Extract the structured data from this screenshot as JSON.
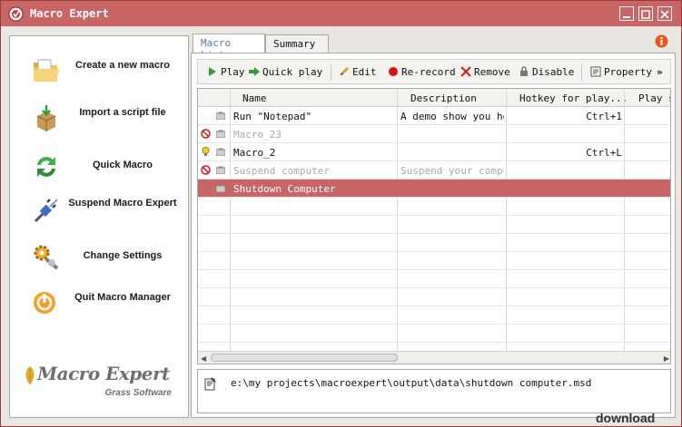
{
  "window": {
    "title": "Macro Expert"
  },
  "sidebar": {
    "actions": [
      {
        "label": "Create a new macro",
        "icon": "folder-icon"
      },
      {
        "label": "Import a script file",
        "icon": "package-icon"
      },
      {
        "label": "Quick Macro",
        "icon": "refresh-icon"
      },
      {
        "label": "Suspend Macro Expert",
        "icon": "plug-icon"
      },
      {
        "label": "Change Settings",
        "icon": "settings-icon"
      },
      {
        "label": "Quit Macro Manager",
        "icon": "power-icon"
      }
    ],
    "brand": {
      "name": "Macro Expert",
      "sub": "Grass Software"
    }
  },
  "tabs": [
    {
      "label": "Macro List"
    },
    {
      "label": "Summary"
    }
  ],
  "toolbar": {
    "play": "Play",
    "quick_play": "Quick play",
    "edit": "Edit",
    "rerecord": "Re-record",
    "remove": "Remove",
    "disable": "Disable",
    "property": "Property",
    "more": "»"
  },
  "table": {
    "columns": [
      "Name",
      "Description",
      "Hotkey for play...",
      "Play s"
    ],
    "rows": [
      {
        "name": "Run \"Notepad\"",
        "description": "A demo show you how",
        "hotkey": "Ctrl+1",
        "status": "enabled",
        "selected": false
      },
      {
        "name": "Macro_23",
        "description": "",
        "hotkey": "",
        "status": "disabled",
        "selected": false
      },
      {
        "name": "Macro_2",
        "description": "",
        "hotkey": "Ctrl+L",
        "status": "bulb",
        "selected": false
      },
      {
        "name": "Suspend computer",
        "description": "Suspend your comput",
        "hotkey": "",
        "status": "disabled",
        "selected": false
      },
      {
        "name": "Shutdown Computer",
        "description": "",
        "hotkey": "",
        "status": "enabled",
        "selected": true
      }
    ]
  },
  "path": "e:\\my projects\\macroexpert\\output\\data\\shutdown computer.msd",
  "watermark": "download",
  "colors": {
    "accent": "#c86666",
    "tab_active": "#5a7bb0"
  }
}
